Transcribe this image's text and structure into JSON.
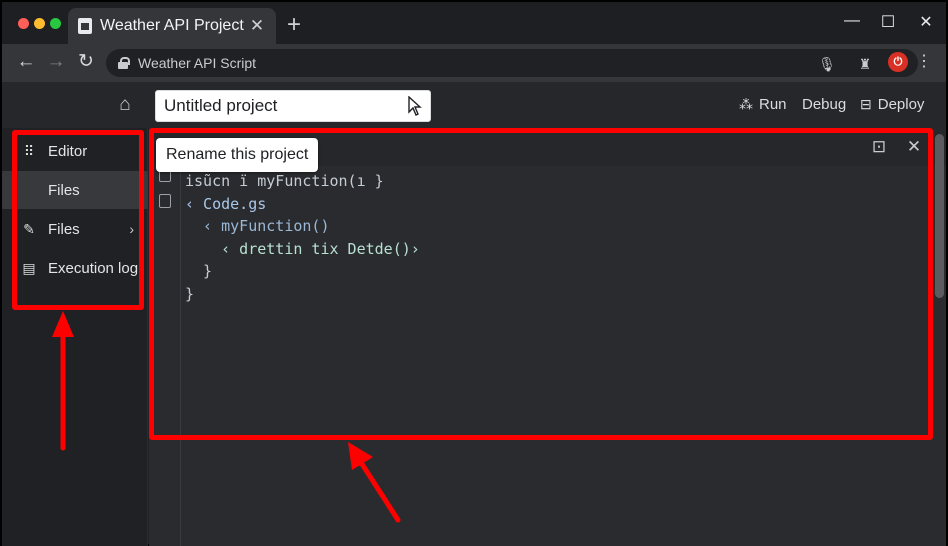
{
  "colors": {
    "accent_red": "#ff0000",
    "traffic_light_red": "#ff5f57",
    "traffic_light_yellow": "#febc2e",
    "traffic_light_green": "#28c840"
  },
  "browser": {
    "tab_title": "Weather API Project",
    "tab_close": "✕",
    "new_tab": "+",
    "url": "Weather API Script",
    "window_controls": {
      "minimize": "—",
      "maximize": "☐",
      "close": "✕"
    }
  },
  "header": {
    "project_name": "Untitled project",
    "actions": [
      {
        "label": "Run",
        "icon": "run-icon"
      },
      {
        "label": "Debug",
        "icon": ""
      },
      {
        "label": "Deploy",
        "icon": "deploy-icon"
      }
    ]
  },
  "sidebar": {
    "items": [
      {
        "label": "Editor",
        "icon": "grid-icon",
        "active": false,
        "chevron": false
      },
      {
        "label": "Files",
        "icon": "",
        "active": true,
        "chevron": false
      },
      {
        "label": "Files",
        "icon": "pencil-icon",
        "active": false,
        "chevron": true
      },
      {
        "label": "Execution log",
        "icon": "log-icon",
        "active": false,
        "chevron": false
      }
    ]
  },
  "tooltip": "Rename this project",
  "editor": {
    "lines": [
      "isũcn ï myFunction(ı }",
      "‹ Code.gs",
      "  ‹ myFunction()",
      "    ‹ drettin tix Detde()›",
      "  }",
      "}"
    ]
  }
}
